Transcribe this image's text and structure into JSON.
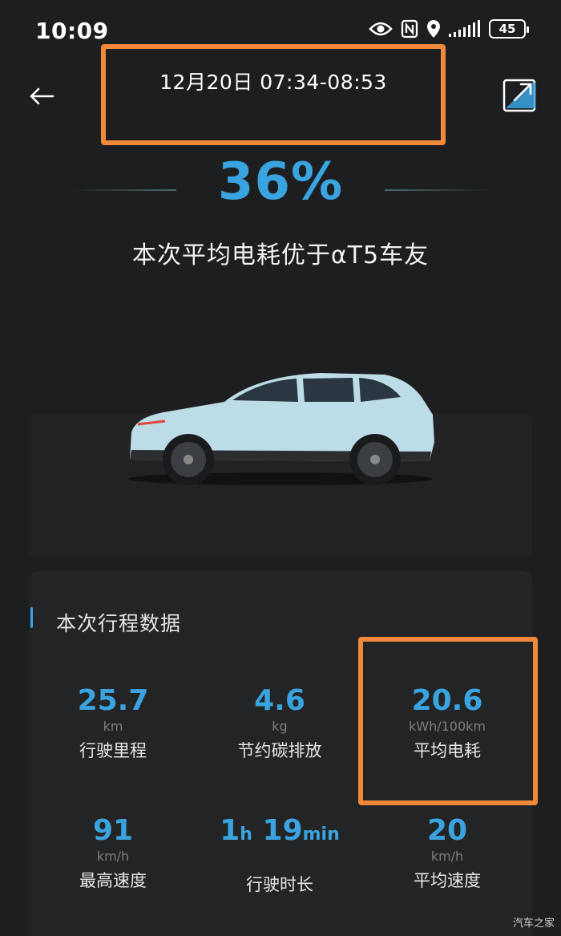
{
  "status_bar": {
    "time": "10:09",
    "battery": "45",
    "icons": [
      "eye-icon",
      "nfc-icon",
      "location-icon",
      "signal-icon",
      "battery-icon"
    ]
  },
  "header": {
    "date_range": "12月20日 07:34-08:53",
    "back_icon": "arrow-left-icon",
    "share_icon": "share-icon"
  },
  "summary": {
    "percent": "36%",
    "compare_text": "本次平均电耗优于αT5车友"
  },
  "trip_data": {
    "title": "本次行程数据",
    "stats": [
      {
        "value": "25.7",
        "unit": "km",
        "label": "行驶里程"
      },
      {
        "value": "4.6",
        "unit": "kg",
        "label": "节约碳排放"
      },
      {
        "value": "20.6",
        "unit": "kWh/100km",
        "label": "平均电耗"
      },
      {
        "value": "91",
        "unit": "km/h",
        "label": "最高速度"
      },
      {
        "value_h": "1",
        "unit_h": "h",
        "value_m": "19",
        "unit_m": "min",
        "label": "行驶时长"
      },
      {
        "value": "20",
        "unit": "km/h",
        "label": "平均速度"
      }
    ]
  },
  "colors": {
    "accent": "#3aa4e0",
    "highlight": "#f2883a",
    "background": "#1d1e20"
  },
  "watermark": "汽车之家"
}
